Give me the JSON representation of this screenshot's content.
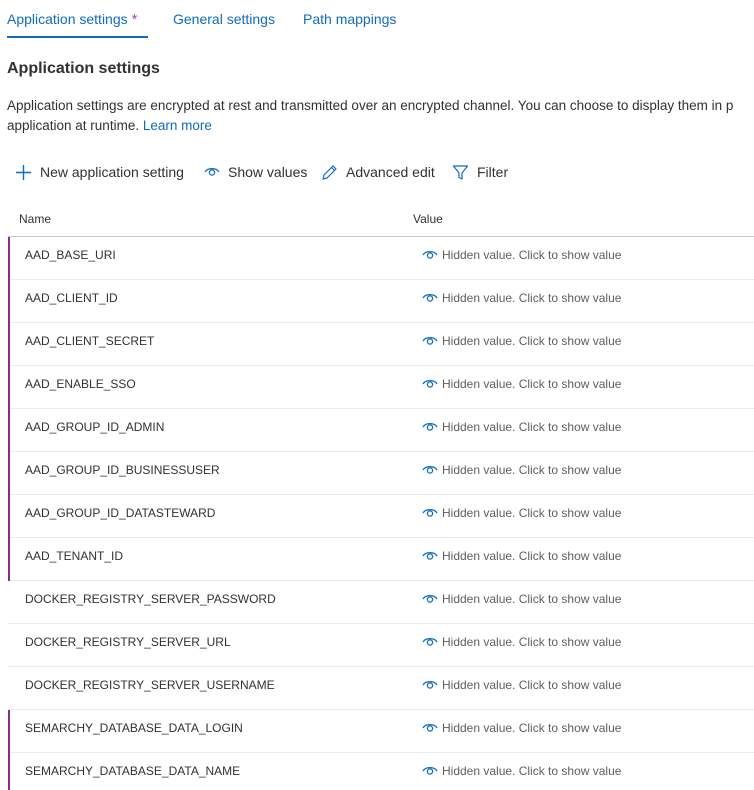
{
  "tabs": [
    {
      "label": "Application settings",
      "modified_marker": "*",
      "active": true
    },
    {
      "label": "General settings",
      "active": false
    },
    {
      "label": "Path mappings",
      "active": false
    }
  ],
  "section": {
    "title": "Application settings",
    "description_line1": "Application settings are encrypted at rest and transmitted over an encrypted channel. You can choose to display them in p",
    "description_line2": "application at runtime.",
    "learn_more": "Learn more"
  },
  "toolbar": {
    "new_setting": "New application setting",
    "show_values": "Show values",
    "advanced_edit": "Advanced edit",
    "filter": "Filter"
  },
  "table": {
    "columns": [
      "Name",
      "Value"
    ],
    "hidden_value_text": "Hidden value. Click to show value",
    "rows": [
      {
        "name": "AAD_BASE_URI",
        "modified": true
      },
      {
        "name": "AAD_CLIENT_ID",
        "modified": true
      },
      {
        "name": "AAD_CLIENT_SECRET",
        "modified": true
      },
      {
        "name": "AAD_ENABLE_SSO",
        "modified": true
      },
      {
        "name": "AAD_GROUP_ID_ADMIN",
        "modified": true
      },
      {
        "name": "AAD_GROUP_ID_BUSINESSUSER",
        "modified": true
      },
      {
        "name": "AAD_GROUP_ID_DATASTEWARD",
        "modified": true
      },
      {
        "name": "AAD_TENANT_ID",
        "modified": true
      },
      {
        "name": "DOCKER_REGISTRY_SERVER_PASSWORD",
        "modified": false
      },
      {
        "name": "DOCKER_REGISTRY_SERVER_URL",
        "modified": false
      },
      {
        "name": "DOCKER_REGISTRY_SERVER_USERNAME",
        "modified": false
      },
      {
        "name": "SEMARCHY_DATABASE_DATA_LOGIN",
        "modified": true
      },
      {
        "name": "SEMARCHY_DATABASE_DATA_NAME",
        "modified": true
      }
    ]
  },
  "colors": {
    "accent": "#0f6cbd",
    "modified_marker": "#8b2a8b",
    "asterisk": "#c239b3"
  }
}
